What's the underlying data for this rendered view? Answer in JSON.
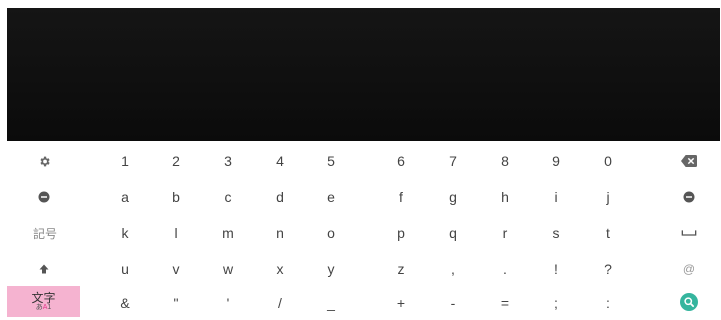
{
  "keyboard": {
    "row1": [
      "1",
      "2",
      "3",
      "4",
      "5",
      "6",
      "7",
      "8",
      "9",
      "0"
    ],
    "row2": [
      "a",
      "b",
      "c",
      "d",
      "e",
      "f",
      "g",
      "h",
      "i",
      "j"
    ],
    "row3_label": "記号",
    "row3": [
      "k",
      "l",
      "m",
      "n",
      "o",
      "p",
      "q",
      "r",
      "s",
      "t"
    ],
    "row4": [
      "u",
      "v",
      "w",
      "x",
      "y",
      "z",
      ",",
      ".",
      "!",
      "?"
    ],
    "row4_right": "@",
    "row5": [
      "&",
      "\"",
      "'",
      "/",
      "_",
      "+",
      "-",
      "=",
      ";",
      ":"
    ],
    "mode_key": {
      "main": "文字",
      "sub_a": "あ",
      "sub_b": "A",
      "sub_c": "1"
    }
  },
  "icons": {
    "settings": "gear-icon",
    "left": "cursor-left-icon",
    "right": "cursor-right-icon",
    "shift": "shift-up-icon",
    "backspace": "backspace-icon",
    "space": "space-icon",
    "search": "search-icon"
  },
  "colors": {
    "accent_pink": "#f5b3d0",
    "search_teal": "#35b59e"
  }
}
